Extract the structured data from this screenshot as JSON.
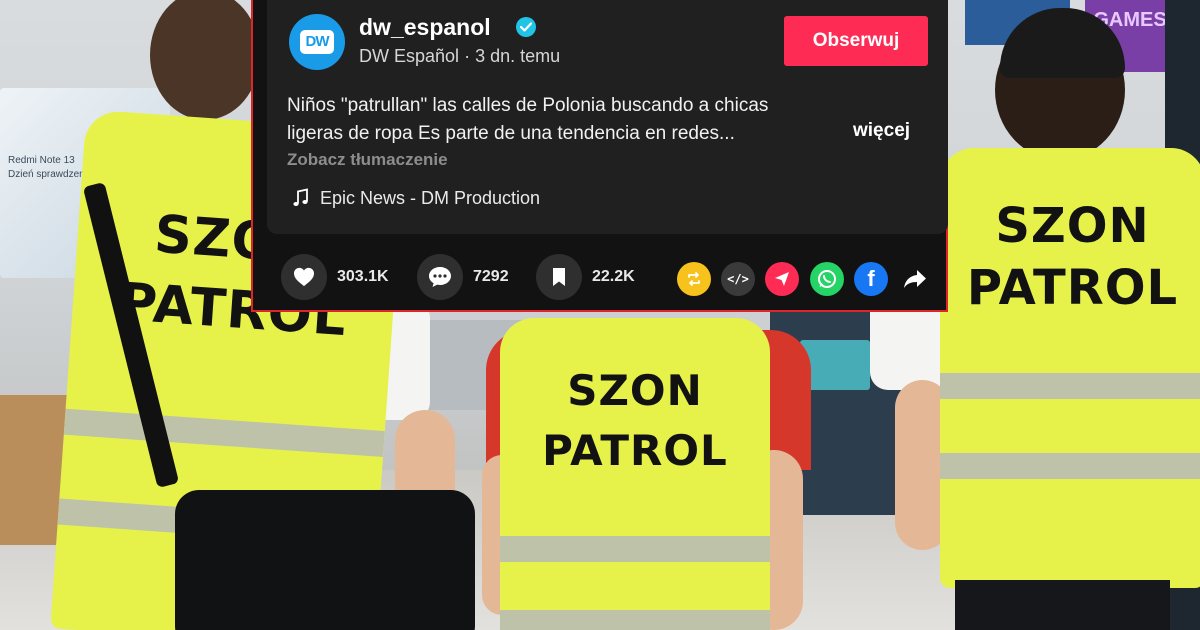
{
  "post": {
    "username": "dw_espanol",
    "avatar_text": "DW",
    "display_name": "DW Español",
    "time_ago": "3 dn. temu",
    "follow_label": "Obserwuj",
    "description_line1": "Niños \"patrullan\" las calles de Polonia buscando a chicas",
    "description_line2": "ligeras de ropa Es parte de una tendencia en redes...",
    "more_label": "więcej",
    "translate_label": "Zobacz tłumaczenie",
    "music": "Epic News - DM Production"
  },
  "stats": {
    "likes": "303.1K",
    "comments": "7292",
    "saves": "22.2K"
  },
  "share_icons": [
    "repost-icon",
    "embed-icon",
    "send-icon",
    "whatsapp-icon",
    "facebook-icon",
    "share-arrow-icon"
  ],
  "embed_glyph": "</>",
  "facebook_glyph": "f",
  "background": {
    "vest_text_line1": "SZON",
    "vest_text_line2": "PATROL",
    "sign_text": "GAMES",
    "promo_line1": "Redmi Note 13",
    "promo_line2": "Dzień sprawdzenia"
  },
  "colors": {
    "follow": "#fe2c55",
    "verified": "#20c4e6",
    "avatar": "#1a9be8",
    "highlight_border": "#e0252a",
    "vest": "#e6f24a"
  }
}
